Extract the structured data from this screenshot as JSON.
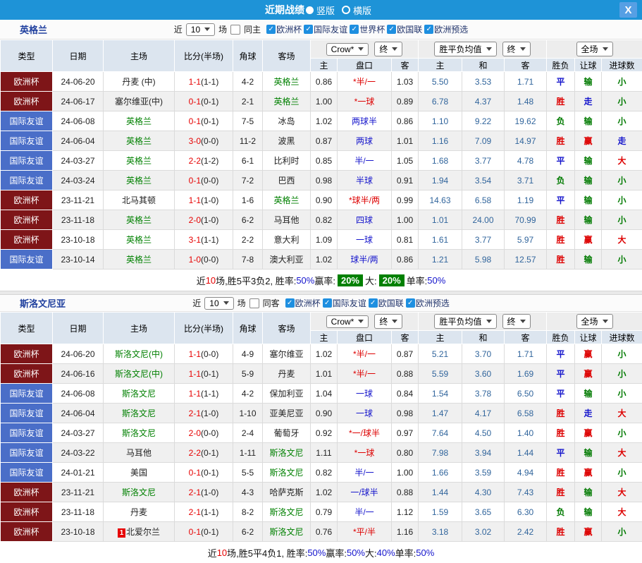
{
  "title_bar": {
    "title": "近期战绩",
    "layout_options": [
      {
        "label": "竖版",
        "selected": true
      },
      {
        "label": "横版",
        "selected": false
      }
    ],
    "close_label": "X"
  },
  "columns": {
    "type": "类型",
    "date": "日期",
    "home": "主场",
    "score": "比分(半场)",
    "corner": "角球",
    "away": "客场",
    "odds_home": "主",
    "handicap": "盘口",
    "odds_away": "客",
    "avg_home": "主",
    "avg_draw": "和",
    "avg_away": "客",
    "result": "胜负",
    "handicap_result": "让球",
    "goals": "进球数"
  },
  "controls": {
    "bookmaker": "Crow*",
    "final_a": "终",
    "avg_select": "胜平负均值",
    "final_b": "终",
    "scope": "全场"
  },
  "colors": {
    "titlebar_bg": "#1E93D7",
    "type_map": {
      "欧洲杯": "#7E1518",
      "国际友谊": "#4A6EC8"
    },
    "result_map": {
      "胜": "#DD0000",
      "平": "#1414CC",
      "负": "#007A00"
    },
    "handicap_result_map": {
      "赢": "#DD0000",
      "走": "#1414CC",
      "输": "#007A00"
    },
    "goals_map": {
      "大": "#DD0000",
      "小": "#007A00",
      "走": "#1414CC"
    },
    "handicap_red": "#DD0000",
    "handicap_blue": "#1414CC",
    "team_highlight": "#008000"
  },
  "sections": [
    {
      "team": "英格兰",
      "filter": {
        "near": "近",
        "matches_value": "10",
        "games": "场",
        "same_label": "同主",
        "same_checked": false,
        "leagues": [
          {
            "label": "欧洲杯",
            "checked": true
          },
          {
            "label": "国际友谊",
            "checked": true
          },
          {
            "label": "世界杯",
            "checked": true
          },
          {
            "label": "欧国联",
            "checked": true
          },
          {
            "label": "欧洲预选",
            "checked": true
          }
        ]
      },
      "rows": [
        {
          "type": "欧洲杯",
          "date": "24-06-20",
          "home": "丹麦 (中)",
          "home_hl": false,
          "home_badge": "",
          "score": "1-1",
          "half": "(1-1)",
          "corner": "4-2",
          "away": "英格兰",
          "away_hl": true,
          "o1": "0.86",
          "handicap": "*半/一",
          "o2": "1.03",
          "a1": "5.50",
          "a2": "3.53",
          "a3": "1.71",
          "res": "平",
          "hres": "输",
          "goals": "小"
        },
        {
          "type": "欧洲杯",
          "date": "24-06-17",
          "home": "塞尔维亚(中)",
          "home_hl": false,
          "home_badge": "",
          "score": "0-1",
          "half": "(0-1)",
          "corner": "2-1",
          "away": "英格兰",
          "away_hl": true,
          "o1": "1.00",
          "handicap": "*一球",
          "o2": "0.89",
          "a1": "6.78",
          "a2": "4.37",
          "a3": "1.48",
          "res": "胜",
          "hres": "走",
          "goals": "小"
        },
        {
          "type": "国际友谊",
          "date": "24-06-08",
          "home": "英格兰",
          "home_hl": true,
          "home_badge": "",
          "score": "0-1",
          "half": "(0-1)",
          "corner": "7-5",
          "away": "冰岛",
          "away_hl": false,
          "o1": "1.02",
          "handicap": "两球半",
          "o2": "0.86",
          "a1": "1.10",
          "a2": "9.22",
          "a3": "19.62",
          "res": "负",
          "hres": "输",
          "goals": "小"
        },
        {
          "type": "国际友谊",
          "date": "24-06-04",
          "home": "英格兰",
          "home_hl": true,
          "home_badge": "",
          "score": "3-0",
          "half": "(0-0)",
          "corner": "11-2",
          "away": "波黑",
          "away_hl": false,
          "o1": "0.87",
          "handicap": "两球",
          "o2": "1.01",
          "a1": "1.16",
          "a2": "7.09",
          "a3": "14.97",
          "res": "胜",
          "hres": "赢",
          "goals": "走"
        },
        {
          "type": "国际友谊",
          "date": "24-03-27",
          "home": "英格兰",
          "home_hl": true,
          "home_badge": "",
          "score": "2-2",
          "half": "(1-2)",
          "corner": "6-1",
          "away": "比利时",
          "away_hl": false,
          "o1": "0.85",
          "handicap": "半/一",
          "o2": "1.05",
          "a1": "1.68",
          "a2": "3.77",
          "a3": "4.78",
          "res": "平",
          "hres": "输",
          "goals": "大"
        },
        {
          "type": "国际友谊",
          "date": "24-03-24",
          "home": "英格兰",
          "home_hl": true,
          "home_badge": "",
          "score": "0-1",
          "half": "(0-0)",
          "corner": "7-2",
          "away": "巴西",
          "away_hl": false,
          "o1": "0.98",
          "handicap": "半球",
          "o2": "0.91",
          "a1": "1.94",
          "a2": "3.54",
          "a3": "3.71",
          "res": "负",
          "hres": "输",
          "goals": "小"
        },
        {
          "type": "欧洲杯",
          "date": "23-11-21",
          "home": "北马其顿",
          "home_hl": false,
          "home_badge": "",
          "score": "1-1",
          "half": "(1-0)",
          "corner": "1-6",
          "away": "英格兰",
          "away_hl": true,
          "o1": "0.90",
          "handicap": "*球半/两",
          "o2": "0.99",
          "a1": "14.63",
          "a2": "6.58",
          "a3": "1.19",
          "res": "平",
          "hres": "输",
          "goals": "小"
        },
        {
          "type": "欧洲杯",
          "date": "23-11-18",
          "home": "英格兰",
          "home_hl": true,
          "home_badge": "",
          "score": "2-0",
          "half": "(1-0)",
          "corner": "6-2",
          "away": "马耳他",
          "away_hl": false,
          "o1": "0.82",
          "handicap": "四球",
          "o2": "1.00",
          "a1": "1.01",
          "a2": "24.00",
          "a3": "70.99",
          "res": "胜",
          "hres": "输",
          "goals": "小"
        },
        {
          "type": "欧洲杯",
          "date": "23-10-18",
          "home": "英格兰",
          "home_hl": true,
          "home_badge": "",
          "score": "3-1",
          "half": "(1-1)",
          "corner": "2-2",
          "away": "意大利",
          "away_hl": false,
          "o1": "1.09",
          "handicap": "一球",
          "o2": "0.81",
          "a1": "1.61",
          "a2": "3.77",
          "a3": "5.97",
          "res": "胜",
          "hres": "赢",
          "goals": "大"
        },
        {
          "type": "国际友谊",
          "date": "23-10-14",
          "home": "英格兰",
          "home_hl": true,
          "home_badge": "",
          "score": "1-0",
          "half": "(0-0)",
          "corner": "7-8",
          "away": "澳大利亚",
          "away_hl": false,
          "o1": "1.02",
          "handicap": "球半/两",
          "o2": "0.86",
          "a1": "1.21",
          "a2": "5.98",
          "a3": "12.57",
          "res": "胜",
          "hres": "输",
          "goals": "小"
        }
      ],
      "summary": [
        {
          "t": "近",
          "s": "plain"
        },
        {
          "t": "10",
          "s": "red"
        },
        {
          "t": "场,胜5平3负2, 胜率:",
          "s": "plain"
        },
        {
          "t": "50%",
          "s": "blue"
        },
        {
          "t": " 赢率:",
          "s": "plain"
        },
        {
          "t": "20%",
          "s": "greenbox"
        },
        {
          "t": " 大:",
          "s": "plain"
        },
        {
          "t": "20%",
          "s": "greenbox"
        },
        {
          "t": " 单率:",
          "s": "plain"
        },
        {
          "t": "50%",
          "s": "blue"
        }
      ]
    },
    {
      "team": "斯洛文尼亚",
      "filter": {
        "near": "近",
        "matches_value": "10",
        "games": "场",
        "same_label": "同客",
        "same_checked": false,
        "leagues": [
          {
            "label": "欧洲杯",
            "checked": true
          },
          {
            "label": "国际友谊",
            "checked": true
          },
          {
            "label": "欧国联",
            "checked": true
          },
          {
            "label": "欧洲预选",
            "checked": true
          }
        ]
      },
      "rows": [
        {
          "type": "欧洲杯",
          "date": "24-06-20",
          "home": "斯洛文尼(中)",
          "home_hl": true,
          "home_badge": "",
          "score": "1-1",
          "half": "(0-0)",
          "corner": "4-9",
          "away": "塞尔维亚",
          "away_hl": false,
          "o1": "1.02",
          "handicap": "*半/一",
          "o2": "0.87",
          "a1": "5.21",
          "a2": "3.70",
          "a3": "1.71",
          "res": "平",
          "hres": "赢",
          "goals": "小"
        },
        {
          "type": "欧洲杯",
          "date": "24-06-16",
          "home": "斯洛文尼(中)",
          "home_hl": true,
          "home_badge": "",
          "score": "1-1",
          "half": "(0-1)",
          "corner": "5-9",
          "away": "丹麦",
          "away_hl": false,
          "o1": "1.01",
          "handicap": "*半/一",
          "o2": "0.88",
          "a1": "5.59",
          "a2": "3.60",
          "a3": "1.69",
          "res": "平",
          "hres": "赢",
          "goals": "小"
        },
        {
          "type": "国际友谊",
          "date": "24-06-08",
          "home": "斯洛文尼",
          "home_hl": true,
          "home_badge": "",
          "score": "1-1",
          "half": "(1-1)",
          "corner": "4-2",
          "away": "保加利亚",
          "away_hl": false,
          "o1": "1.04",
          "handicap": "一球",
          "o2": "0.84",
          "a1": "1.54",
          "a2": "3.78",
          "a3": "6.50",
          "res": "平",
          "hres": "输",
          "goals": "小"
        },
        {
          "type": "国际友谊",
          "date": "24-06-04",
          "home": "斯洛文尼",
          "home_hl": true,
          "home_badge": "",
          "score": "2-1",
          "half": "(1-0)",
          "corner": "1-10",
          "away": "亚美尼亚",
          "away_hl": false,
          "o1": "0.90",
          "handicap": "一球",
          "o2": "0.98",
          "a1": "1.47",
          "a2": "4.17",
          "a3": "6.58",
          "res": "胜",
          "hres": "走",
          "goals": "大"
        },
        {
          "type": "国际友谊",
          "date": "24-03-27",
          "home": "斯洛文尼",
          "home_hl": true,
          "home_badge": "",
          "score": "2-0",
          "half": "(0-0)",
          "corner": "2-4",
          "away": "葡萄牙",
          "away_hl": false,
          "o1": "0.92",
          "handicap": "*一/球半",
          "o2": "0.97",
          "a1": "7.64",
          "a2": "4.50",
          "a3": "1.40",
          "res": "胜",
          "hres": "赢",
          "goals": "小"
        },
        {
          "type": "国际友谊",
          "date": "24-03-22",
          "home": "马耳他",
          "home_hl": false,
          "home_badge": "",
          "score": "2-2",
          "half": "(0-1)",
          "corner": "1-11",
          "away": "斯洛文尼",
          "away_hl": true,
          "o1": "1.11",
          "handicap": "*一球",
          "o2": "0.80",
          "a1": "7.98",
          "a2": "3.94",
          "a3": "1.44",
          "res": "平",
          "hres": "输",
          "goals": "大"
        },
        {
          "type": "国际友谊",
          "date": "24-01-21",
          "home": "美国",
          "home_hl": false,
          "home_badge": "",
          "score": "0-1",
          "half": "(0-1)",
          "corner": "5-5",
          "away": "斯洛文尼",
          "away_hl": true,
          "o1": "0.82",
          "handicap": "半/一",
          "o2": "1.00",
          "a1": "1.66",
          "a2": "3.59",
          "a3": "4.94",
          "res": "胜",
          "hres": "赢",
          "goals": "小"
        },
        {
          "type": "欧洲杯",
          "date": "23-11-21",
          "home": "斯洛文尼",
          "home_hl": true,
          "home_badge": "",
          "score": "2-1",
          "half": "(1-0)",
          "corner": "4-3",
          "away": "哈萨克斯",
          "away_hl": false,
          "o1": "1.02",
          "handicap": "一/球半",
          "o2": "0.88",
          "a1": "1.44",
          "a2": "4.30",
          "a3": "7.43",
          "res": "胜",
          "hres": "输",
          "goals": "大"
        },
        {
          "type": "欧洲杯",
          "date": "23-11-18",
          "home": "丹麦",
          "home_hl": false,
          "home_badge": "",
          "score": "2-1",
          "half": "(1-1)",
          "corner": "8-2",
          "away": "斯洛文尼",
          "away_hl": true,
          "o1": "0.79",
          "handicap": "半/一",
          "o2": "1.12",
          "a1": "1.59",
          "a2": "3.65",
          "a3": "6.30",
          "res": "负",
          "hres": "输",
          "goals": "大"
        },
        {
          "type": "欧洲杯",
          "date": "23-10-18",
          "home": "北爱尔兰",
          "home_hl": false,
          "home_badge": "1",
          "score": "0-1",
          "half": "(0-1)",
          "corner": "6-2",
          "away": "斯洛文尼",
          "away_hl": true,
          "o1": "0.76",
          "handicap": "*平/半",
          "o2": "1.16",
          "a1": "3.18",
          "a2": "3.02",
          "a3": "2.42",
          "res": "胜",
          "hres": "赢",
          "goals": "小"
        }
      ],
      "summary": [
        {
          "t": "近",
          "s": "plain"
        },
        {
          "t": "10",
          "s": "red"
        },
        {
          "t": "场,胜5平4负1, 胜率:",
          "s": "plain"
        },
        {
          "t": "50%",
          "s": "blue"
        },
        {
          "t": " 赢率:",
          "s": "plain"
        },
        {
          "t": "50%",
          "s": "blue"
        },
        {
          "t": " 大:",
          "s": "plain"
        },
        {
          "t": "40%",
          "s": "blue"
        },
        {
          "t": " 单率:",
          "s": "plain"
        },
        {
          "t": "50%",
          "s": "blue"
        }
      ]
    }
  ]
}
